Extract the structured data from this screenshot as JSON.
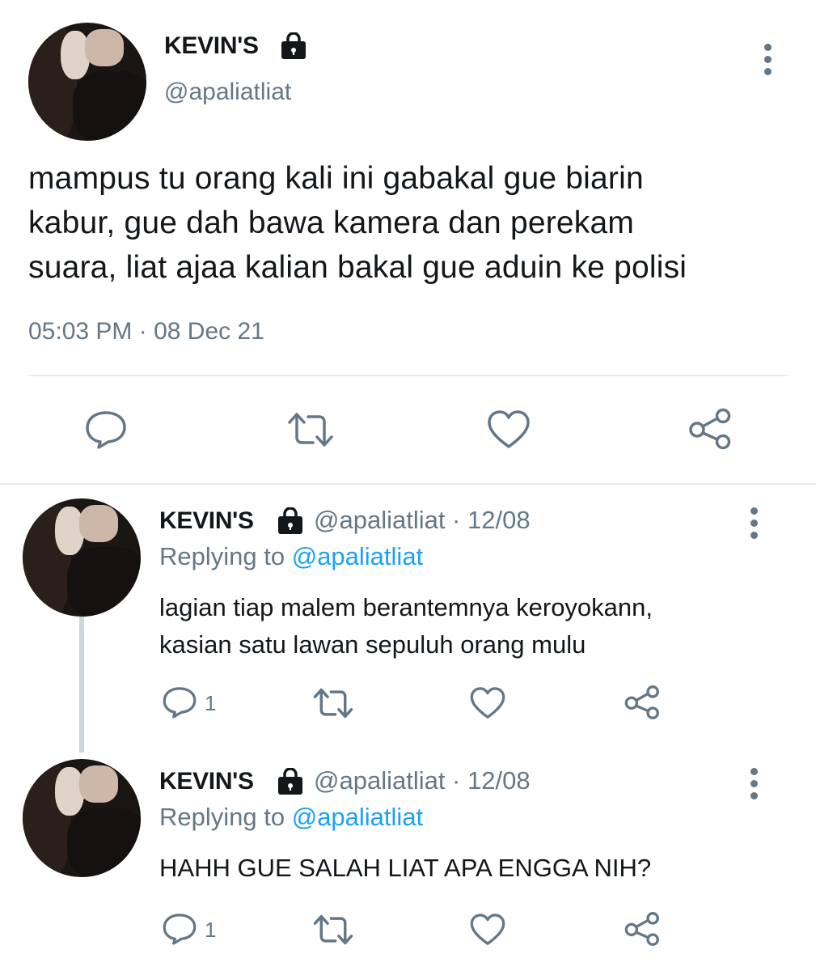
{
  "main_tweet": {
    "display_name": "KEVIN'S",
    "handle": "@apaliatliat",
    "text_lines": [
      "mampus tu orang kali ini gabakal gue biarin",
      "kabur, gue dah bawa kamera dan perekam",
      "suara, liat ajaa kalian bakal gue aduin ke polisi"
    ],
    "timestamp": "05:03 PM · 08 Dec 21",
    "actions": [
      "reply-icon",
      "retweet-icon",
      "like-icon",
      "share-icon"
    ]
  },
  "replies": [
    {
      "display_name": "KEVIN'S",
      "handle_date": "@apaliatliat · 12/08",
      "replying_prefix": "Replying to",
      "replying_to": "@apaliatliat",
      "text_lines": [
        "lagian tiap malem berantemnya keroyokann,",
        "kasian satu lawan sepuluh orang mulu"
      ],
      "reply_count": "1"
    },
    {
      "display_name": "KEVIN'S",
      "handle_date": "@apaliatliat · 12/08",
      "replying_prefix": "Replying to",
      "replying_to": "@apaliatliat",
      "text_lines": [
        "HAHH GUE SALAH LIAT APA ENGGA NIH?"
      ],
      "reply_count": "1"
    }
  ],
  "colors": {
    "muted": "#657786",
    "link": "#1da1f2",
    "divider": "#e6ecf0",
    "thread_line": "#ccd6dd"
  }
}
